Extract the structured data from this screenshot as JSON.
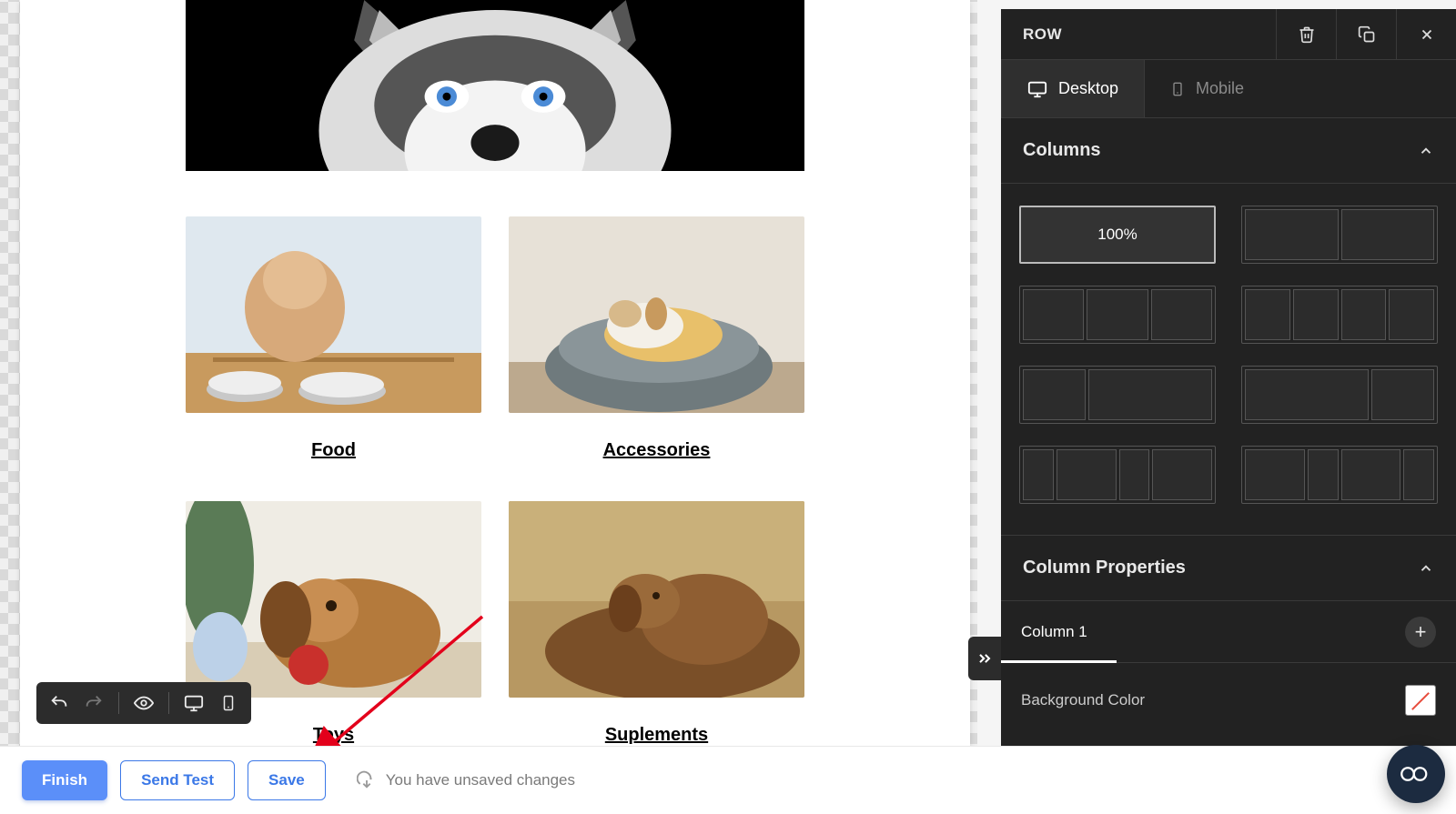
{
  "bottom": {
    "finish": "Finish",
    "send_test": "Send Test",
    "save": "Save",
    "unsaved": "You have unsaved changes"
  },
  "canvas": {
    "cards": [
      {
        "label": "Food"
      },
      {
        "label": "Accessories"
      },
      {
        "label": "Toys"
      },
      {
        "label": "Suplements"
      }
    ]
  },
  "sidebar": {
    "title": "ROW",
    "tabs": {
      "desktop": "Desktop",
      "mobile": "Mobile"
    },
    "sections": {
      "columns": "Columns",
      "column_props": "Column Properties",
      "bg_color": "Background Color"
    },
    "column_layouts": {
      "selected_label": "100%"
    },
    "column_tab": "Column 1"
  }
}
